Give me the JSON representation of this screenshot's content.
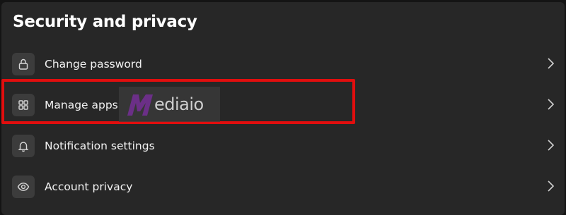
{
  "section": {
    "title": "Security and privacy"
  },
  "items": [
    {
      "label": "Change password",
      "icon": "lock-icon"
    },
    {
      "label": "Manage apps",
      "icon": "apps-grid-icon"
    },
    {
      "label": "Notification settings",
      "icon": "bell-icon"
    },
    {
      "label": "Account privacy",
      "icon": "eye-icon"
    }
  ],
  "watermark": {
    "text": "ediaio"
  },
  "colors": {
    "background": "#272727",
    "icon_box": "#3c3c3c",
    "highlight": "#e10e0e",
    "watermark_mark": "#6b2f87"
  }
}
